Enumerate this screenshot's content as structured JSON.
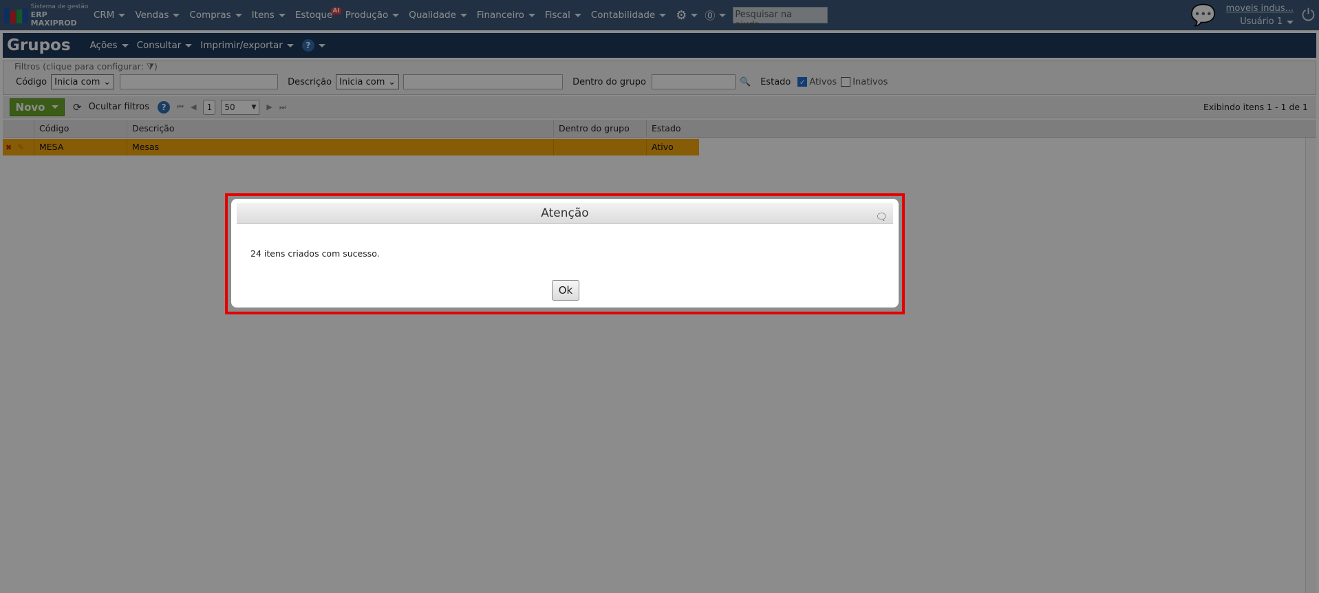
{
  "brand": {
    "small": "Sistema de gestão",
    "big": "ERP MAXIPROD"
  },
  "nav": {
    "items": [
      "CRM",
      "Vendas",
      "Compras",
      "Itens",
      "Estoque",
      "Produção",
      "Qualidade",
      "Financeiro",
      "Fiscal",
      "Contabilidade"
    ],
    "ai_badge": "AI",
    "search_placeholder": "Pesquisar na ajuda...",
    "company": "moveis indus...",
    "user": "Usuário 1"
  },
  "title": {
    "page_title": "Grupos",
    "menus": [
      "Ações",
      "Consultar",
      "Imprimir/exportar"
    ],
    "help": "?"
  },
  "filters": {
    "legend": "Filtros (clique para configurar:",
    "legend_close": ")",
    "codigo_label": "Código",
    "codigo_op": "Inicia com",
    "descricao_label": "Descrição",
    "descricao_op": "Inicia com",
    "grupo_label": "Dentro do grupo",
    "estado_label": "Estado",
    "ativos_label": "Ativos",
    "ativos_checked": true,
    "inativos_label": "Inativos",
    "inativos_checked": false
  },
  "toolbar": {
    "new_label": "Novo",
    "hide_filters": "Ocultar filtros",
    "help": "?",
    "page": "1",
    "page_size": "50",
    "showing": "Exibindo itens 1 - 1 de 1"
  },
  "grid": {
    "columns": [
      "Código",
      "Descrição",
      "Dentro do grupo",
      "Estado"
    ],
    "rows": [
      {
        "codigo": "MESA",
        "descricao": "Mesas",
        "grupo": "",
        "estado": "Ativo"
      }
    ]
  },
  "dialog": {
    "title": "Atenção",
    "message": "24 itens criados com sucesso.",
    "ok": "Ok"
  },
  "colors": {
    "accent_row": "#f5a80b",
    "highlight_border": "#e40000",
    "new_button": "#6aa82a",
    "nav_bg": "#3d5a7a"
  }
}
